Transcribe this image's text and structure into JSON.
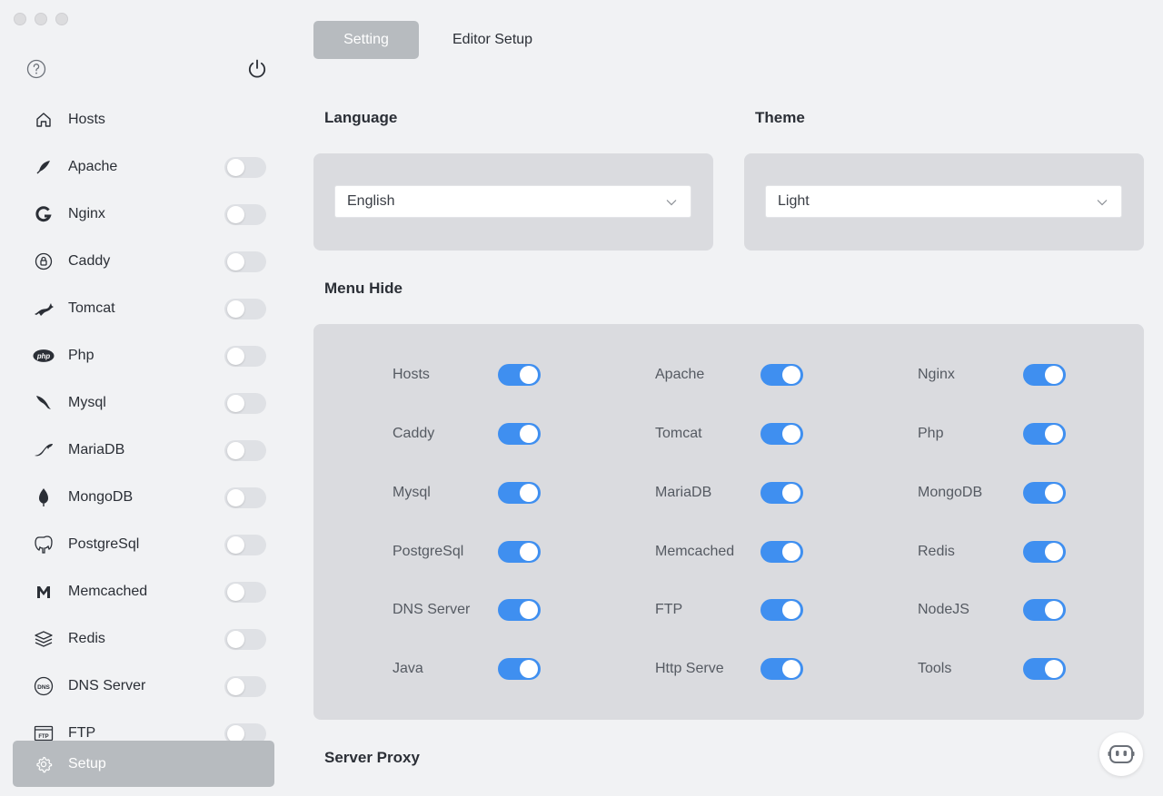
{
  "tabs": {
    "active": "Setting",
    "other": "Editor Setup"
  },
  "sidebar": {
    "items": [
      {
        "label": "Hosts",
        "icon": "home-icon",
        "has_toggle": false
      },
      {
        "label": "Apache",
        "icon": "apache-feather-icon",
        "has_toggle": true,
        "on": false
      },
      {
        "label": "Nginx",
        "icon": "nginx-icon",
        "has_toggle": true,
        "on": false
      },
      {
        "label": "Caddy",
        "icon": "caddy-icon",
        "has_toggle": true,
        "on": false
      },
      {
        "label": "Tomcat",
        "icon": "tomcat-icon",
        "has_toggle": true,
        "on": false
      },
      {
        "label": "Php",
        "icon": "php-icon",
        "has_toggle": true,
        "on": false
      },
      {
        "label": "Mysql",
        "icon": "mysql-dolphin-icon",
        "has_toggle": true,
        "on": false
      },
      {
        "label": "MariaDB",
        "icon": "mariadb-seal-icon",
        "has_toggle": true,
        "on": false
      },
      {
        "label": "MongoDB",
        "icon": "mongodb-leaf-icon",
        "has_toggle": true,
        "on": false
      },
      {
        "label": "PostgreSql",
        "icon": "postgresql-elephant-icon",
        "has_toggle": true,
        "on": false
      },
      {
        "label": "Memcached",
        "icon": "memcached-icon",
        "has_toggle": true,
        "on": false
      },
      {
        "label": "Redis",
        "icon": "redis-stack-icon",
        "has_toggle": true,
        "on": false
      },
      {
        "label": "DNS Server",
        "icon": "dns-icon",
        "has_toggle": true,
        "on": false
      },
      {
        "label": "FTP",
        "icon": "ftp-icon",
        "has_toggle": true,
        "on": false
      }
    ],
    "setup_label": "Setup"
  },
  "language": {
    "title": "Language",
    "value": "English"
  },
  "theme": {
    "title": "Theme",
    "value": "Light"
  },
  "menu_hide": {
    "title": "Menu Hide",
    "items": [
      {
        "label": "Hosts",
        "on": true
      },
      {
        "label": "Apache",
        "on": true
      },
      {
        "label": "Nginx",
        "on": true
      },
      {
        "label": "Caddy",
        "on": true
      },
      {
        "label": "Tomcat",
        "on": true
      },
      {
        "label": "Php",
        "on": true
      },
      {
        "label": "Mysql",
        "on": true
      },
      {
        "label": "MariaDB",
        "on": true
      },
      {
        "label": "MongoDB",
        "on": true
      },
      {
        "label": "PostgreSql",
        "on": true
      },
      {
        "label": "Memcached",
        "on": true
      },
      {
        "label": "Redis",
        "on": true
      },
      {
        "label": "DNS Server",
        "on": true
      },
      {
        "label": "FTP",
        "on": true
      },
      {
        "label": "NodeJS",
        "on": true
      },
      {
        "label": "Java",
        "on": true
      },
      {
        "label": "Http Serve",
        "on": true
      },
      {
        "label": "Tools",
        "on": true
      }
    ]
  },
  "server_proxy": {
    "title": "Server Proxy"
  },
  "colors": {
    "accent": "#3f8ff0",
    "active_tab": "#b7bbbf",
    "panel": "#dadbdf",
    "background": "#f1f2f4"
  }
}
